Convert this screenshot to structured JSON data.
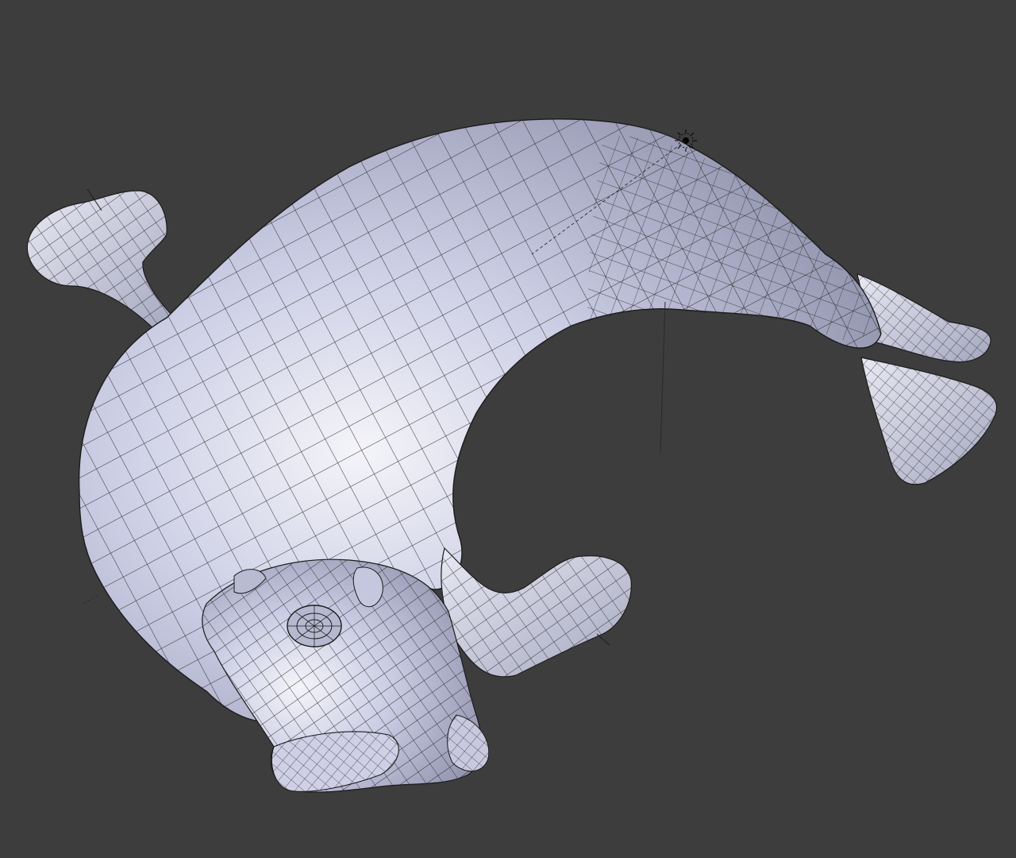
{
  "viewport": {
    "background": "#3d3d3d",
    "shading": "solid",
    "overlay": "wireframe",
    "mesh_color": "#c9cbe2",
    "highlight_color": "#f3f3f8",
    "shadow_color": "#8f90a8",
    "wire_color": "#1c1c1c"
  },
  "mesh": {
    "subject": "seal",
    "parts": [
      "body",
      "head",
      "left-front-flipper",
      "right-front-flipper",
      "rear-flipper-upper",
      "rear-flipper-lower",
      "eye",
      "snout"
    ]
  },
  "scene_objects": [
    {
      "name": "light-icon"
    },
    {
      "name": "camera-line-icon"
    }
  ]
}
